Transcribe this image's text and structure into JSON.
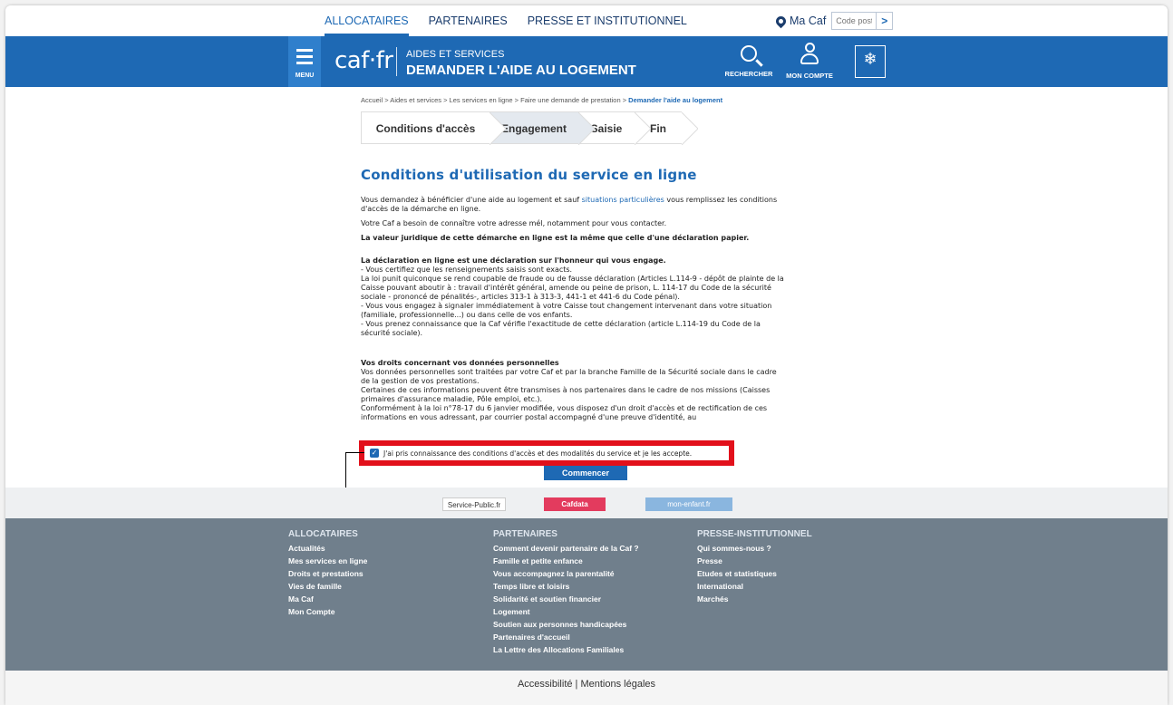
{
  "topnav": {
    "items": [
      "ALLOCATAIRES",
      "PARTENAIRES",
      "PRESSE ET INSTITUTIONNEL"
    ],
    "macaf_label": "Ma Caf",
    "postal_placeholder": "Code postal",
    "go_label": ">"
  },
  "header": {
    "menu_label": "MENU",
    "logo": "caf·fr",
    "subtitle": "AIDES ET SERVICES",
    "title": "DEMANDER L'AIDE AU LOGEMENT",
    "search_label": "RECHERCHER",
    "account_label": "MON COMPTE",
    "gov_logo": "❄"
  },
  "breadcrumb": {
    "path": "Accueil > Aides et services > Les services en ligne > Faire une demande de prestation > ",
    "current": "Demander l'aide au logement"
  },
  "steps": [
    "Conditions d'accès",
    "Engagement",
    "Saisie",
    "Fin"
  ],
  "content": {
    "title": "Conditions d'utilisation du service en ligne",
    "p1_before": "Vous demandez à bénéficier d'une aide au logement et sauf ",
    "p1_link": "situations particulières",
    "p1_after": " vous remplissez les conditions d'accès de la démarche en ligne.",
    "p2": "Votre Caf a besoin de connaître votre adresse mél, notamment pour vous contacter.",
    "p3": "La valeur juridique de cette démarche en ligne est la même que celle d'une déclaration papier.",
    "decl_title": "La déclaration en ligne est une déclaration sur l'honneur qui vous engage.",
    "decl_lines": [
      "- Vous certifiez que les renseignements saisis sont exacts.",
      "La loi punit quiconque se rend coupable de fraude ou de fausse déclaration (Articles L.114-9 - dépôt de plainte de la Caisse pouvant aboutir à : travail d'intérêt général, amende ou peine de prison, L. 114-17 du Code de la sécurité sociale - prononcé de pénalités-, articles 313-1 à 313-3, 441-1 et 441-6 du Code pénal).",
      "- Vous vous engagez à signaler immédiatement à votre Caisse tout changement intervenant dans votre situation (familiale, professionnelle...) ou dans celle de vos enfants.",
      "- Vous prenez connaissance que la Caf vérifie l'exactitude de cette déclaration (article L.114-19 du Code de la sécurité sociale)."
    ],
    "rights_title": "Vos droits concernant vos données personnelles",
    "rights_lines": [
      "Vos données personnelles sont traitées par votre Caf et par la branche Famille de la Sécurité sociale dans le cadre de la gestion de vos prestations.",
      "Certaines de ces informations peuvent être transmises à nos partenaires dans le cadre de nos missions (Caisses primaires d'assurance maladie, Pôle emploi, etc.).",
      "Conformément à la loi n°78-17 du 6 janvier modifiée, vous disposez d'un droit d'accès et de rectification de ces informations en vous adressant, par courrier postal accompagné d'une preuve d'identité, au"
    ],
    "accept_label": "J'ai pris connaissance des conditions d'accès et des modalités du service et je les accepte.",
    "start_button": "Commencer"
  },
  "partners": [
    "Service-Public.fr",
    "Cafdata",
    "mon-enfant.fr"
  ],
  "footer": {
    "columns": [
      {
        "title": "ALLOCATAIRES",
        "items": [
          "Actualités",
          "Mes services en ligne",
          "Droits et prestations",
          "Vies de famille",
          "Ma Caf",
          "Mon Compte"
        ]
      },
      {
        "title": "PARTENAIRES",
        "items": [
          "Comment devenir partenaire de la Caf ?",
          "Famille et petite enfance",
          "Vous accompagnez la parentalité",
          "Temps libre et loisirs",
          "Solidarité et soutien financier",
          "Logement",
          "Soutien aux personnes handicapées",
          "Partenaires d'accueil",
          "La Lettre des Allocations Familiales"
        ]
      },
      {
        "title": "PRESSE-INSTITUTIONNEL",
        "items": [
          "Qui sommes-nous ?",
          "Presse",
          "Etudes et statistiques",
          "International",
          "Marchés"
        ]
      }
    ],
    "legal": "Accessibilité  |  Mentions légales"
  },
  "colors": {
    "primary": "#1e69b4",
    "highlight": "#e2101b",
    "footer": "#707f8c"
  }
}
